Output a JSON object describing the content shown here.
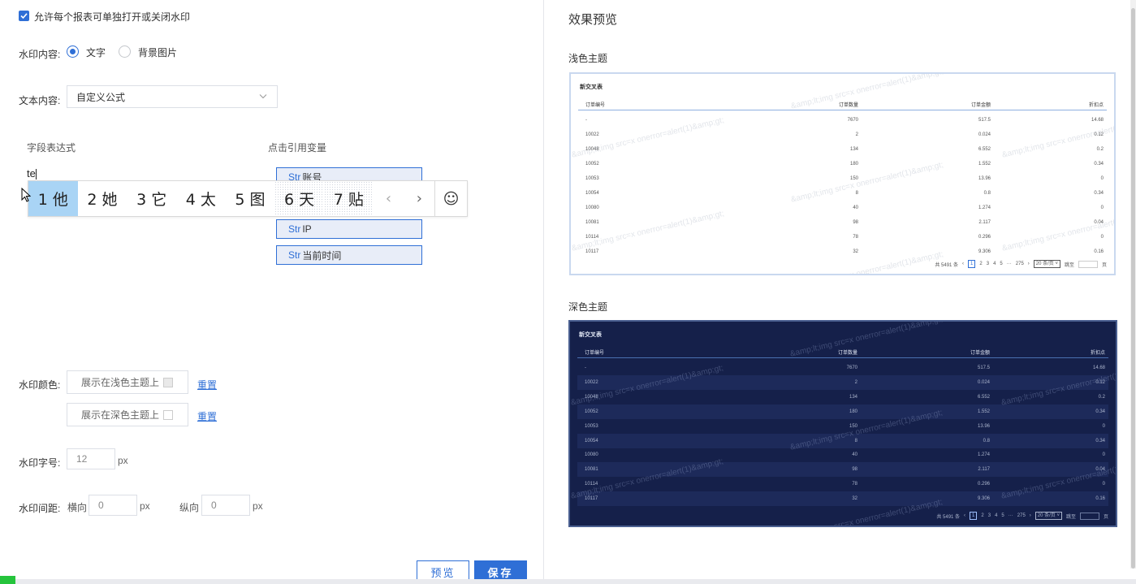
{
  "settings": {
    "allow_toggle_label": "允许每个报表可单独打开或关闭水印",
    "content_label": "水印内容:",
    "content_options": [
      "文字",
      "背景图片"
    ],
    "text_content_label": "文本内容:",
    "text_content_value": "自定义公式",
    "field_expr_label": "字段表达式",
    "field_expr_value": "te",
    "click_var_label": "点击引用变量",
    "variables": [
      {
        "type": "Str",
        "name": "账号"
      },
      {
        "type": "Str",
        "name": "IP"
      },
      {
        "type": "Str",
        "name": "当前时间"
      }
    ],
    "color_label": "水印颜色:",
    "color_light_label": "展示在浅色主题上",
    "color_dark_label": "展示在深色主题上",
    "reset_label": "重置",
    "size_label": "水印字号:",
    "size_value": "12",
    "unit_px": "px",
    "spacing_label": "水印间距:",
    "spacing_h_label": "横向",
    "spacing_h_value": "0",
    "spacing_v_label": "纵向",
    "spacing_v_value": "0",
    "preview_button": "预览",
    "save_button": "保存"
  },
  "ime": {
    "candidates": [
      "1 他",
      "2 她",
      "3 它",
      "4 太",
      "5 图",
      "6 天",
      "7 贴"
    ],
    "prev": "‹",
    "next": "›",
    "emoji": "☺"
  },
  "preview": {
    "title": "效果预览",
    "light_label": "浅色主题",
    "dark_label": "深色主题",
    "table_title": "新交叉表",
    "columns": [
      "订单编号",
      "订单数量",
      "订单金额",
      "折扣点"
    ],
    "rows": [
      [
        "-",
        "7670",
        "517.5",
        "14.68"
      ],
      [
        "10022",
        "2",
        "0.024",
        "0.12"
      ],
      [
        "10048",
        "134",
        "6.552",
        "0.2"
      ],
      [
        "10052",
        "180",
        "1.552",
        "0.34"
      ],
      [
        "10053",
        "150",
        "13.96",
        "0"
      ],
      [
        "10054",
        "8",
        "0.8",
        "0.34"
      ],
      [
        "10080",
        "40",
        "1.274",
        "0"
      ],
      [
        "10081",
        "98",
        "2.117",
        "0.04"
      ],
      [
        "10114",
        "78",
        "0.296",
        "0"
      ],
      [
        "10117",
        "32",
        "9.306",
        "0.16"
      ]
    ],
    "pagination": {
      "total": "共 5491 条",
      "pages": [
        "1",
        "2",
        "3",
        "4",
        "5",
        "···",
        "275"
      ],
      "page_size": "20 条/页",
      "jump": "跳至",
      "page_unit": "页"
    },
    "watermark_text": "&amp;lt;img src=x onerror=alert(1)&amp;gt;"
  },
  "colors": {
    "accent": "#2f6fd6",
    "dark_bg": "#15204a"
  }
}
